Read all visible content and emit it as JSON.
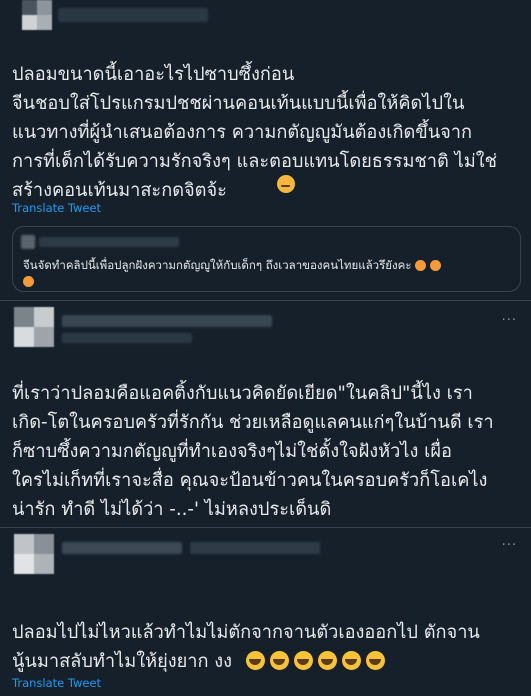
{
  "tweets": [
    {
      "text": "ปลอมขนาดนี้เอาอะไรไปซาบซึ้งก่อน\nจีนชอบใส่โปรแกรมปชชผ่านคอนเท้นแบบนี้เพื่อให้คิดไปใน\nแนวทางที่ผู้นำเสนอต้องการ ความกตัญญูมันต้องเกิดขึ้นจาก\nการที่เด็กได้รับความรักจริงๆ และตอบแทนโดยธรรมชาติ ไม่ใช่\nสร้างคอนเท้นมาสะกดจิตจ้ะ",
      "emoji": "pensive-face",
      "translate_label": "Translate Tweet",
      "quote_text": "จีนจัดทำคลิปนี้เพื่อปลูกฝังความกตัญญูให้กับเด็กๆ ถึงเวลาของคนไทยแล้วรึยังคะ"
    },
    {
      "text": "ที่เราว่าปลอมคือแอคติ้งกับแนวคิดยัดเยียด\"ในคลิป\"นี้ไง เรา\nเกิด-โตในครอบครัวที่รักกัน ช่วยเหลือดูแลคนแก่ๆในบ้านดี เรา\nก็ซาบซึ้งความกตัญญูที่ทำเองจริงๆไม่ใช่ตั้งใจฝังหัวไง เผื่อ\nใครไม่เก็ทที่เราจะสื่อ คุณจะป้อนข้าวคนในครอบครัวก็โอเคไง\nน่ารัก ทำดี ไม่ได้ว่า -..-' ไม่หลงประเด็นดิ",
      "more_label": "···"
    },
    {
      "text": "ปลอมไปไม่ไหวแล้วทำไมไม่ตักจากจานตัวเองออกไป ตักจาน\nนู้นมาสลับทำไมให้ยุ่งยาก งง",
      "emoji": "rolling-laughing-face",
      "emoji_count": 6,
      "translate_label": "Translate Tweet",
      "more_label": "···"
    }
  ],
  "colors": {
    "background": "#15202b",
    "text": "#e7e9ea",
    "link": "#1d9bf0",
    "border": "#38444d"
  }
}
